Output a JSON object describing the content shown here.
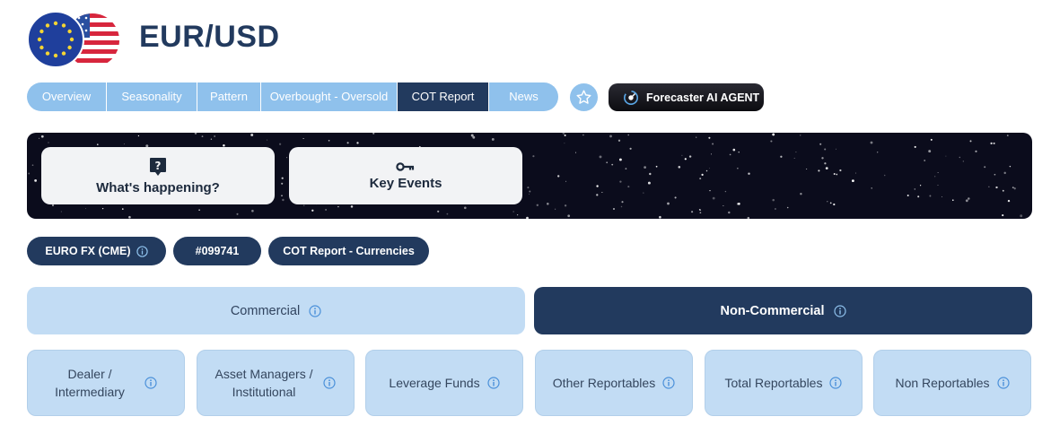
{
  "header": {
    "title": "EUR/USD"
  },
  "tabs": [
    {
      "label": "Overview",
      "active": false
    },
    {
      "label": "Seasonality",
      "active": false
    },
    {
      "label": "Pattern",
      "active": false
    },
    {
      "label": "Overbought - Oversold",
      "active": false
    },
    {
      "label": "COT Report",
      "active": true
    },
    {
      "label": "News",
      "active": false
    }
  ],
  "ai_button": {
    "label": "Forecaster AI AGENT"
  },
  "banner": {
    "cards": [
      {
        "label": "What's happening?",
        "icon": "question-icon"
      },
      {
        "label": "Key Events",
        "icon": "key-icon"
      }
    ]
  },
  "chips": [
    {
      "label": "EURO FX (CME)",
      "has_info": true
    },
    {
      "label": "#099741",
      "has_info": false
    },
    {
      "label": "COT Report - Currencies",
      "has_info": false
    }
  ],
  "categories": [
    {
      "label": "Commercial",
      "active": false
    },
    {
      "label": "Non-Commercial",
      "active": true
    }
  ],
  "sub_tabs": [
    {
      "line1": "Dealer /",
      "line2": "Intermediary"
    },
    {
      "line1": "Asset Managers /",
      "line2": "Institutional"
    },
    {
      "line1": "Leverage Funds",
      "line2": ""
    },
    {
      "line1": "Other Reportables",
      "line2": ""
    },
    {
      "line1": "Total Reportables",
      "line2": ""
    },
    {
      "line1": "Non Reportables",
      "line2": ""
    }
  ],
  "colors": {
    "navy": "#223a5e",
    "light_blue": "#8fc1ec",
    "pale_blue": "#c2dcf4",
    "banner_bg": "#0b0c1c"
  }
}
